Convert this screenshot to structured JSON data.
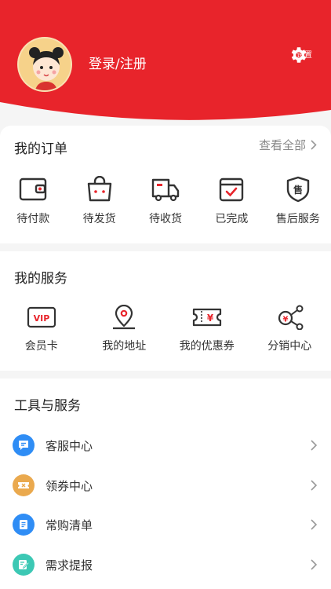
{
  "colors": {
    "brand": "#e8242b",
    "icon_dark": "#333333",
    "text_muted": "#888888"
  },
  "header": {
    "login_label": "登录/注册",
    "settings_label": "设置",
    "settings_icon": "gear-icon"
  },
  "orders": {
    "title": "我的订单",
    "view_all": "查看全部",
    "items": [
      {
        "label": "待付款",
        "icon": "wallet-icon"
      },
      {
        "label": "待发货",
        "icon": "bag-icon"
      },
      {
        "label": "待收货",
        "icon": "truck-icon"
      },
      {
        "label": "已完成",
        "icon": "calendar-check-icon"
      },
      {
        "label": "售后服务",
        "icon": "shield-service-icon",
        "glyph": "售"
      }
    ]
  },
  "services": {
    "title": "我的服务",
    "items": [
      {
        "label": "会员卡",
        "icon": "vip-card-icon",
        "glyph": "VIP"
      },
      {
        "label": "我的地址",
        "icon": "location-pin-icon"
      },
      {
        "label": "我的优惠券",
        "icon": "coupon-icon",
        "glyph": "¥"
      },
      {
        "label": "分销中心",
        "icon": "distribution-icon",
        "glyph": "¥"
      }
    ]
  },
  "tools": {
    "title": "工具与服务",
    "items": [
      {
        "label": "客服中心",
        "icon": "chat-icon",
        "color": "#2f8df5"
      },
      {
        "label": "领券中心",
        "icon": "ticket-icon",
        "color": "#eaa94e"
      },
      {
        "label": "常购清单",
        "icon": "list-icon",
        "color": "#2f8df5"
      },
      {
        "label": "需求提报",
        "icon": "edit-icon",
        "color": "#3cc8b4"
      }
    ]
  }
}
